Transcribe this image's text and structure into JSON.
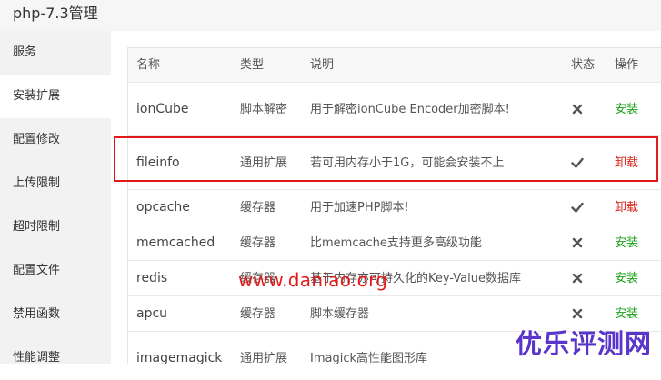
{
  "window": {
    "title": "php-7.3管理"
  },
  "sidebar": {
    "items": [
      {
        "label": "服务"
      },
      {
        "label": "安装扩展",
        "active": true
      },
      {
        "label": "配置修改"
      },
      {
        "label": "上传限制"
      },
      {
        "label": "超时限制"
      },
      {
        "label": "配置文件"
      },
      {
        "label": "禁用函数"
      },
      {
        "label": "性能调整"
      }
    ]
  },
  "table": {
    "headers": {
      "name": "名称",
      "type": "类型",
      "desc": "说明",
      "status": "状态",
      "action": "操作"
    },
    "rows": [
      {
        "name": "ionCube",
        "type": "脚本解密",
        "desc": "用于解密ionCube Encoder加密脚本!",
        "status": "times-icon",
        "action": "安装"
      },
      {
        "name": "fileinfo",
        "type": "通用扩展",
        "desc": "若可用内存小于1G，可能会安装不上",
        "status": "check-icon",
        "action": "卸载"
      },
      {
        "name": "opcache",
        "type": "缓存器",
        "desc": "用于加速PHP脚本!",
        "status": "check-icon",
        "action": "卸载"
      },
      {
        "name": "memcached",
        "type": "缓存器",
        "desc": "比memcache支持更多高级功能",
        "status": "times-icon",
        "action": "安装"
      },
      {
        "name": "redis",
        "type": "缓存器",
        "desc": "基于内存亦可持久化的Key-Value数据库",
        "status": "times-icon",
        "action": "安装"
      },
      {
        "name": "apcu",
        "type": "缓存器",
        "desc": "脚本缓存器",
        "status": "times-icon",
        "action": "安装"
      },
      {
        "name": "imagemagick",
        "type": "通用扩展",
        "desc": "Imagick高性能图形库",
        "status": "",
        "action": ""
      }
    ]
  },
  "watermarks": {
    "url": "www.daniao.org",
    "brand": "优乐评测网"
  },
  "colors": {
    "install": "#1aa01a",
    "uninstall": "#d9231c",
    "highlight": "#e01919",
    "brand": "#5a35c9"
  }
}
